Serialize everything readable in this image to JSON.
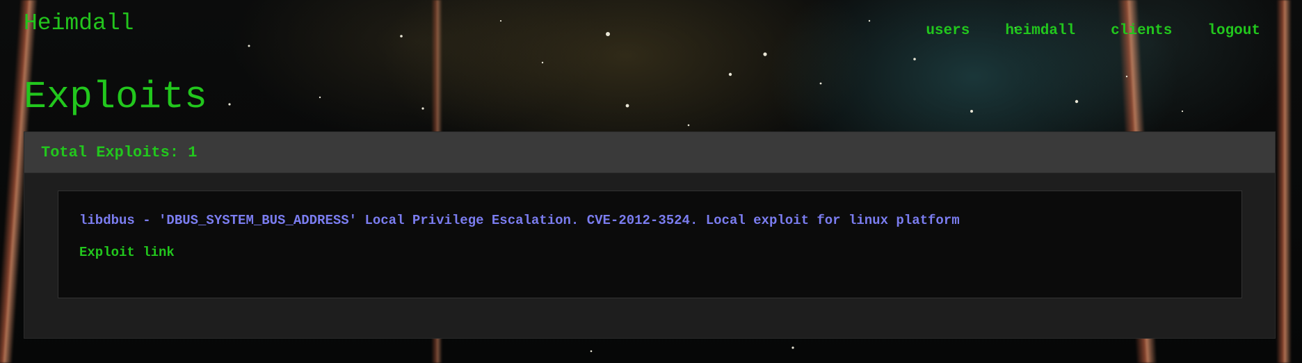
{
  "header": {
    "brand": "Heimdall",
    "nav": [
      {
        "label": "users"
      },
      {
        "label": "heimdall"
      },
      {
        "label": "clients"
      },
      {
        "label": "logout"
      }
    ]
  },
  "page": {
    "title": "Exploits"
  },
  "panel": {
    "heading": "Total Exploits: 1",
    "exploits": [
      {
        "title": "libdbus - 'DBUS_SYSTEM_BUS_ADDRESS' Local Privilege Escalation. CVE-2012-3524. Local exploit for linux platform",
        "link_label": "Exploit link"
      }
    ]
  },
  "colors": {
    "accent_green": "#22c71d",
    "exploit_title": "#7b7df0",
    "panel_bg": "#1e1e1e",
    "panel_heading_bg": "#3a3a3a",
    "card_bg": "#0b0b0b"
  }
}
